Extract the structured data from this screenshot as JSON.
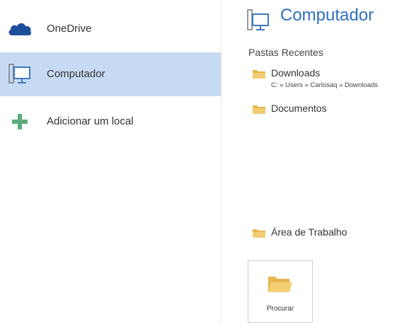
{
  "locations": [
    {
      "label": "OneDrive",
      "icon": "onedrive-cloud-icon",
      "selected": false
    },
    {
      "label": "Computador",
      "icon": "computer-icon",
      "selected": true
    },
    {
      "label": "Adicionar um local",
      "icon": "add-plus-icon",
      "selected": false
    }
  ],
  "header": {
    "title": "Computador",
    "icon": "computer-icon"
  },
  "recent": {
    "title": "Pastas Recentes",
    "folders": [
      {
        "name": "Downloads",
        "path": "C: » Users » Carlosaq » Downloads"
      },
      {
        "name": "Documentos"
      }
    ]
  },
  "desktop_folder": {
    "name": "Área de Trabalho"
  },
  "browse": {
    "label": "Procurar",
    "icon": "open-folder-icon"
  },
  "colors": {
    "accent": "#2f6fbf",
    "selected_bg": "#c7daf3",
    "onedrive": "#1e4e9c",
    "plus": "#5aab7d",
    "folder": "#e8b64f"
  }
}
